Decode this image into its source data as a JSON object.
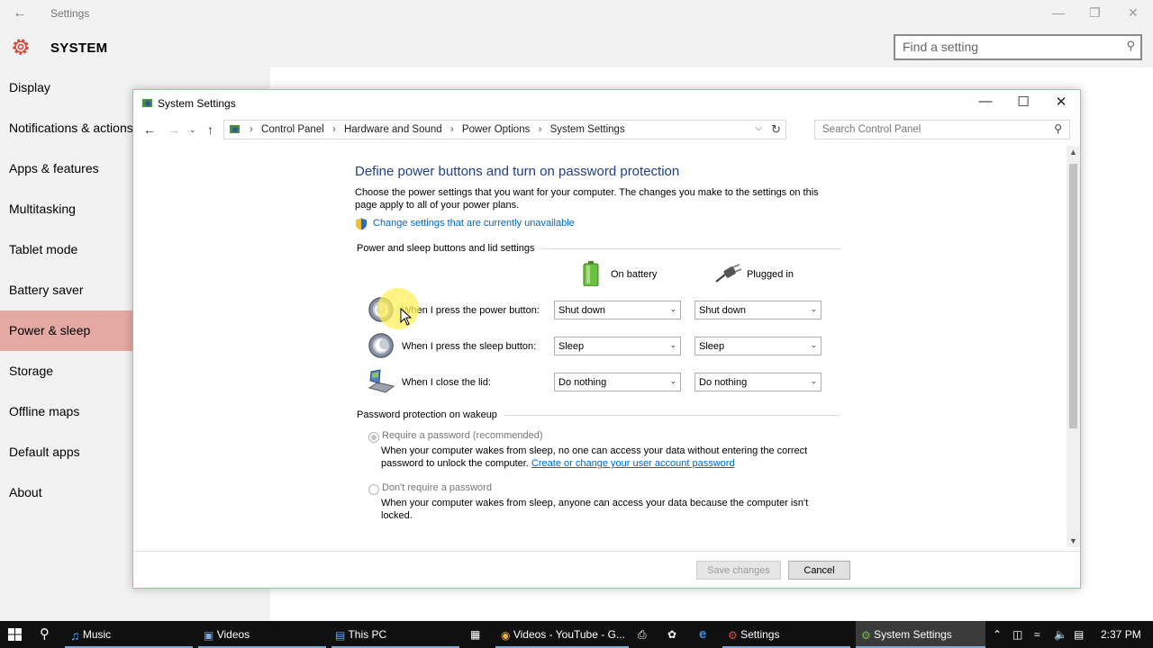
{
  "settings_app": {
    "title": "Settings",
    "heading": "SYSTEM",
    "search_placeholder": "Find a setting",
    "nav_items": [
      {
        "label": "Display"
      },
      {
        "label": "Notifications & actions"
      },
      {
        "label": "Apps & features"
      },
      {
        "label": "Multitasking"
      },
      {
        "label": "Tablet mode"
      },
      {
        "label": "Battery saver"
      },
      {
        "label": "Power & sleep"
      },
      {
        "label": "Storage"
      },
      {
        "label": "Offline maps"
      },
      {
        "label": "Default apps"
      },
      {
        "label": "About"
      }
    ],
    "active_nav": "Power & sleep"
  },
  "dialog": {
    "title": "System Settings",
    "breadcrumbs": [
      "Control Panel",
      "Hardware and Sound",
      "Power Options",
      "System Settings"
    ],
    "search_placeholder": "Search Control Panel",
    "heading": "Define power buttons and turn on password protection",
    "description": "Choose the power settings that you want for your computer. The changes you make to the settings on this page apply to all of your power plans.",
    "change_link": "Change settings that are currently unavailable",
    "section_buttons": "Power and sleep buttons and lid settings",
    "col_battery": "On battery",
    "col_plugged": "Plugged in",
    "rows": [
      {
        "label": "When I press the power button:",
        "battery": "Shut down",
        "plugged": "Shut down"
      },
      {
        "label": "When I press the sleep button:",
        "battery": "Sleep",
        "plugged": "Sleep"
      },
      {
        "label": "When I close the lid:",
        "battery": "Do nothing",
        "plugged": "Do nothing"
      }
    ],
    "section_password": "Password protection on wakeup",
    "require_label": "Require a password (recommended)",
    "require_desc": "When your computer wakes from sleep, no one can access your data without entering the correct password to unlock the computer.",
    "require_link": "Create or change your user account password",
    "norequire_label": "Don't require a password",
    "norequire_desc": "When your computer wakes from sleep, anyone can access your data because the computer isn't locked.",
    "save_label": "Save changes",
    "cancel_label": "Cancel"
  },
  "taskbar": {
    "apps": [
      {
        "label": "Music"
      },
      {
        "label": "Videos"
      },
      {
        "label": "This PC"
      },
      {
        "label": "Videos - YouTube - G..."
      },
      {
        "label": "Settings"
      },
      {
        "label": "System Settings"
      }
    ],
    "clock": "2:37 PM"
  },
  "colors": {
    "accent_nav": "#e4a9a2",
    "link": "#0066cc",
    "heading": "#1e3f8c",
    "taskbar": "#101010"
  }
}
